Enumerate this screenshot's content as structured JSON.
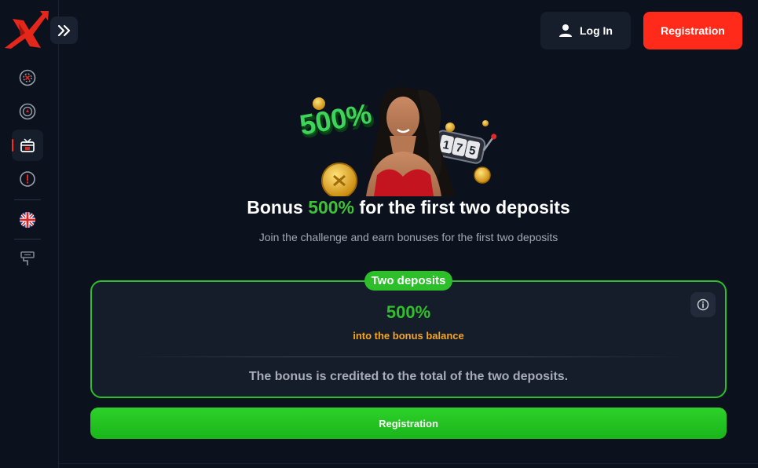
{
  "header": {
    "login_label": "Log In",
    "registration_label": "Registration"
  },
  "sidebar": {
    "items": [
      {
        "icon": "casino-chip-icon"
      },
      {
        "icon": "sports-ball-icon"
      },
      {
        "icon": "promotions-gift-icon",
        "active": true
      },
      {
        "icon": "alert-icon"
      },
      {
        "icon": "uk-flag-icon"
      },
      {
        "icon": "customize-icon"
      }
    ]
  },
  "hero": {
    "promo_number": "500%",
    "slot_digits": "175"
  },
  "promo": {
    "title_prefix": "Bonus",
    "title_accent": "500%",
    "title_suffix": "for the first two deposits",
    "subtitle": "Join the challenge and earn bonuses for the first two deposits"
  },
  "card": {
    "badge": "Two deposits",
    "value": "500%",
    "value_caption": "into the bonus balance",
    "note": "The bonus is credited to the total of the two deposits."
  },
  "cta": {
    "label": "Registration"
  },
  "colors": {
    "background": "#0b111d",
    "accent_red": "#ff2a1a",
    "accent_green": "#2dbf2a",
    "accent_orange": "#f5a623"
  }
}
